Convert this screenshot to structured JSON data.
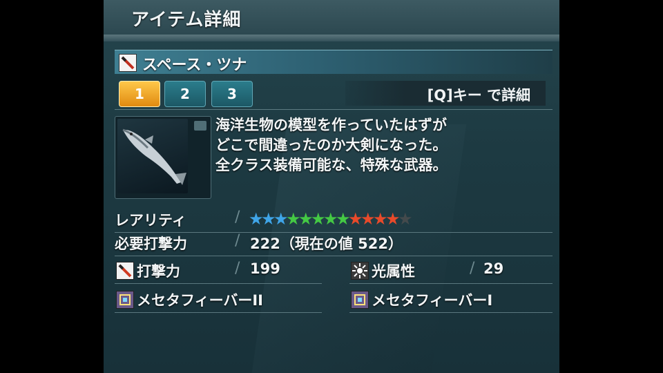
{
  "header": {
    "title": "アイテム詳細"
  },
  "item": {
    "name": "スペース・ツナ"
  },
  "tabs": [
    {
      "label": "1",
      "active": true
    },
    {
      "label": "2",
      "active": false
    },
    {
      "label": "3",
      "active": false
    }
  ],
  "hint": "[Q]キー で詳細",
  "description": [
    "海洋生物の模型を作っていたはずが",
    "どこで間違ったのか大剣になった。",
    "全クラス装備可能な、特殊な武器。"
  ],
  "stats": {
    "rarity_label": "レアリティ",
    "rarity_stars": 12,
    "rarity_max": 13,
    "star_glyph": "★",
    "star_colors": [
      "#3fa5e8",
      "#3fa5e8",
      "#3fa5e8",
      "#44c944",
      "#44c944",
      "#44c944",
      "#44c944",
      "#44c944",
      "#e84a2a",
      "#e84a2a",
      "#e84a2a",
      "#e84a2a",
      "#444a4c"
    ],
    "required_label": "必要打撃力",
    "required_value": "222（現在の値 522）",
    "attack_label": "打撃力",
    "attack_value": "199",
    "element_label": "光属性",
    "element_value": "29",
    "ability1": "メセタフィーバーII",
    "ability2": "メセタフィーバーI"
  },
  "colors": {
    "panel": "#1d3a42",
    "tab_active": "#f0a020",
    "tab_inactive": "#22707e"
  },
  "icons": {
    "weapon": "sword-icon",
    "attack": "attack-icon",
    "element": "light-element-icon",
    "ability": "ability-icon"
  }
}
